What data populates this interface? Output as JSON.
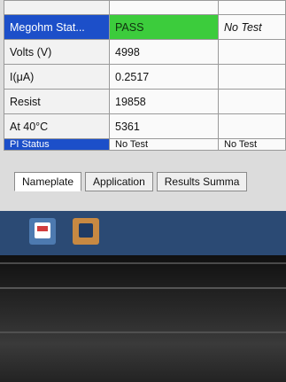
{
  "grid": {
    "top_row": {
      "label": "",
      "value": ""
    },
    "rows": [
      {
        "label": "Megohm Stat...",
        "value": "PASS",
        "extra": "No Test"
      },
      {
        "label": "Volts (V)",
        "value": "4998",
        "extra": ""
      },
      {
        "label": "I(μA)",
        "value": "0.2517",
        "extra": ""
      },
      {
        "label": "Resist",
        "value": "19858",
        "extra": ""
      },
      {
        "label": "At 40°C",
        "value": "5361",
        "extra": ""
      }
    ],
    "status_row": {
      "label": "PI Status",
      "value": "No Test",
      "extra": "No Test"
    }
  },
  "tabs": [
    "Nameplate",
    "Application",
    "Results Summa"
  ],
  "colors": {
    "highlight": "#1c4fc9",
    "pass": "#3ccc3c",
    "taskbar": "#2b4a74"
  },
  "taskbar": {
    "items": [
      "app-icon",
      "app-icon"
    ]
  }
}
